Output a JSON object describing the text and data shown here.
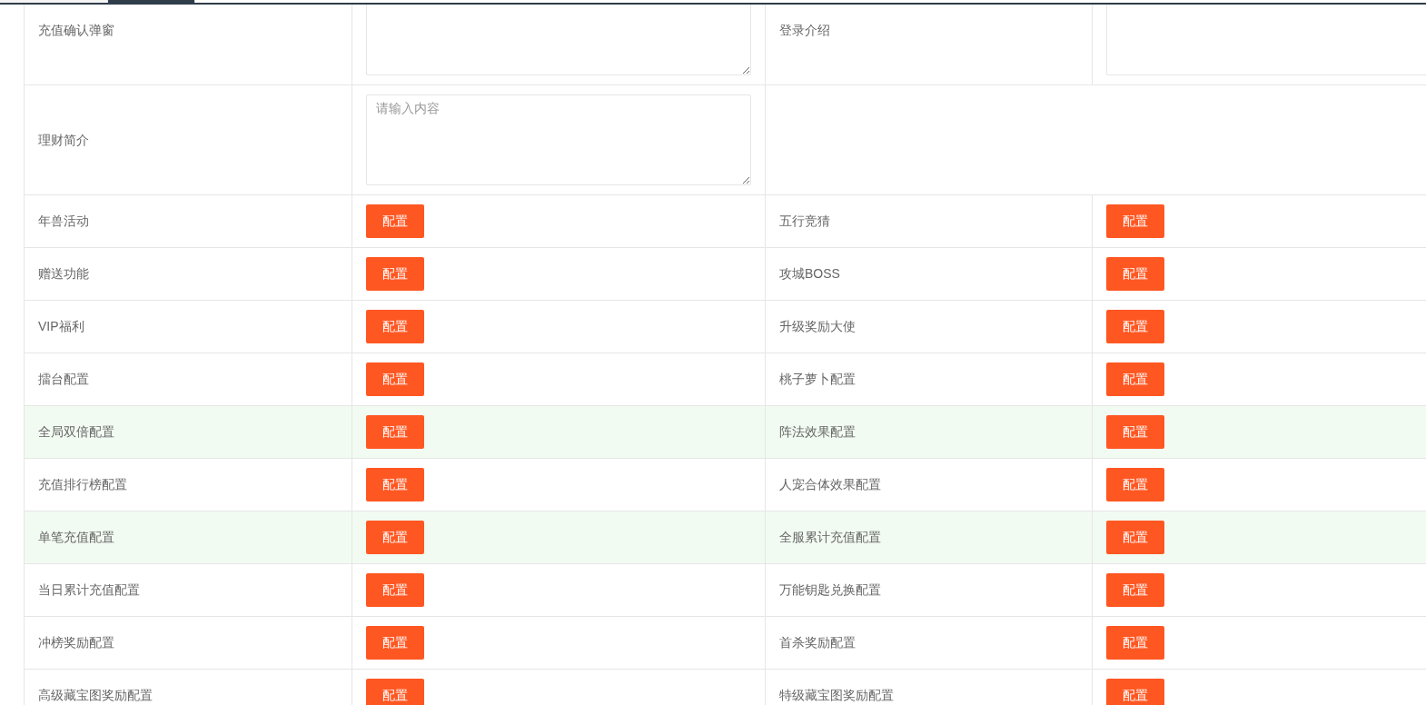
{
  "tab_strip": {
    "tabs": [
      {
        "selected": false
      },
      {
        "selected": true
      }
    ]
  },
  "text_rows": [
    {
      "cells": [
        {
          "label": "充值确认弹窗",
          "kind": "textarea"
        },
        {
          "label": "登录介绍",
          "kind": "textarea"
        }
      ]
    },
    {
      "cells": [
        {
          "label": "理财简介",
          "kind": "textarea",
          "placeholder": "请输入内容"
        }
      ]
    }
  ],
  "config_rows": [
    {
      "highlighted": false,
      "items": [
        {
          "label": "年兽活动",
          "button": "配置"
        },
        {
          "label": "五行竞猜",
          "button": "配置"
        }
      ]
    },
    {
      "highlighted": false,
      "items": [
        {
          "label": "赠送功能",
          "button": "配置"
        },
        {
          "label": "攻城BOSS",
          "button": "配置"
        }
      ]
    },
    {
      "highlighted": false,
      "items": [
        {
          "label": "VIP福利",
          "button": "配置"
        },
        {
          "label": "升级奖励大使",
          "button": "配置"
        }
      ]
    },
    {
      "highlighted": false,
      "items": [
        {
          "label": "擂台配置",
          "button": "配置"
        },
        {
          "label": "桃子萝卜配置",
          "button": "配置"
        }
      ]
    },
    {
      "highlighted": true,
      "items": [
        {
          "label": "全局双倍配置",
          "button": "配置"
        },
        {
          "label": "阵法效果配置",
          "button": "配置"
        }
      ]
    },
    {
      "highlighted": false,
      "items": [
        {
          "label": "充值排行榜配置",
          "button": "配置"
        },
        {
          "label": "人宠合体效果配置",
          "button": "配置"
        }
      ]
    },
    {
      "highlighted": true,
      "items": [
        {
          "label": "单笔充值配置",
          "button": "配置"
        },
        {
          "label": "全服累计充值配置",
          "button": "配置"
        }
      ]
    },
    {
      "highlighted": false,
      "items": [
        {
          "label": "当日累计充值配置",
          "button": "配置"
        },
        {
          "label": "万能钥匙兑换配置",
          "button": "配置"
        }
      ]
    },
    {
      "highlighted": false,
      "items": [
        {
          "label": "冲榜奖励配置",
          "button": "配置"
        },
        {
          "label": "首杀奖励配置",
          "button": "配置"
        }
      ]
    },
    {
      "highlighted": false,
      "items": [
        {
          "label": "高级藏宝图奖励配置",
          "button": "配置"
        },
        {
          "label": "特级藏宝图奖励配置",
          "button": "配置"
        }
      ]
    }
  ]
}
